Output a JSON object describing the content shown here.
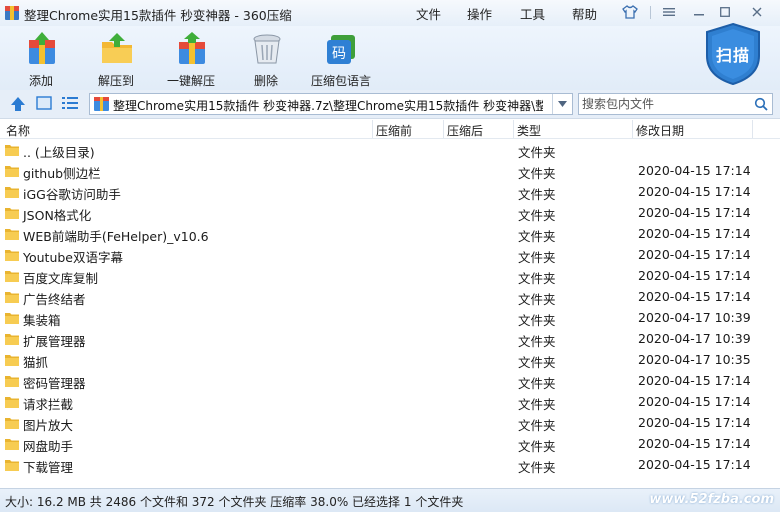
{
  "window": {
    "title": "整理Chrome实用15款插件 秒变神器 - 360压缩"
  },
  "menu": {
    "file": "文件",
    "operations": "操作",
    "tools": "工具",
    "help": "帮助"
  },
  "toolbar": {
    "add": "添加",
    "extract_to": "解压到",
    "one_click_extract": "一键解压",
    "delete": "删除",
    "archive_language": "压缩包语言",
    "scan": "扫描",
    "lang_glyph": "码"
  },
  "address": {
    "path": "整理Chrome实用15款插件 秒变神器.7z\\整理Chrome实用15款插件 秒变神器\\整理"
  },
  "search": {
    "placeholder": "搜索包内文件"
  },
  "columns": {
    "name": "名称",
    "compressed": "压缩前",
    "after": "压缩后",
    "type": "类型",
    "modified": "修改日期"
  },
  "files": [
    {
      "name": ".. (上级目录)",
      "type": "文件夹",
      "date": ""
    },
    {
      "name": "github侧边栏",
      "type": "文件夹",
      "date": "2020-04-15 17:14"
    },
    {
      "name": "iGG谷歌访问助手",
      "type": "文件夹",
      "date": "2020-04-15 17:14"
    },
    {
      "name": "JSON格式化",
      "type": "文件夹",
      "date": "2020-04-15 17:14"
    },
    {
      "name": "WEB前端助手(FeHelper)_v10.6",
      "type": "文件夹",
      "date": "2020-04-15 17:14"
    },
    {
      "name": "Youtube双语字幕",
      "type": "文件夹",
      "date": "2020-04-15 17:14"
    },
    {
      "name": "百度文库复制",
      "type": "文件夹",
      "date": "2020-04-15 17:14"
    },
    {
      "name": "广告终结者",
      "type": "文件夹",
      "date": "2020-04-15 17:14"
    },
    {
      "name": "集装箱",
      "type": "文件夹",
      "date": "2020-04-17 10:39"
    },
    {
      "name": "扩展管理器",
      "type": "文件夹",
      "date": "2020-04-17 10:39"
    },
    {
      "name": "猫抓",
      "type": "文件夹",
      "date": "2020-04-17 10:35"
    },
    {
      "name": "密码管理器",
      "type": "文件夹",
      "date": "2020-04-15 17:14"
    },
    {
      "name": "请求拦截",
      "type": "文件夹",
      "date": "2020-04-15 17:14"
    },
    {
      "name": "图片放大",
      "type": "文件夹",
      "date": "2020-04-15 17:14"
    },
    {
      "name": "网盘助手",
      "type": "文件夹",
      "date": "2020-04-15 17:14"
    },
    {
      "name": "下载管理",
      "type": "文件夹",
      "date": "2020-04-15 17:14"
    }
  ],
  "status": {
    "text": "大小: 16.2 MB 共 2486 个文件和 372 个文件夹 压缩率 38.0% 已经选择 1 个文件夹",
    "watermark": "www.52fzba.com"
  },
  "colors": {
    "accent": "#1e6fc0",
    "folder": "#f5c542",
    "scan_badge": "#2f7fd0"
  }
}
